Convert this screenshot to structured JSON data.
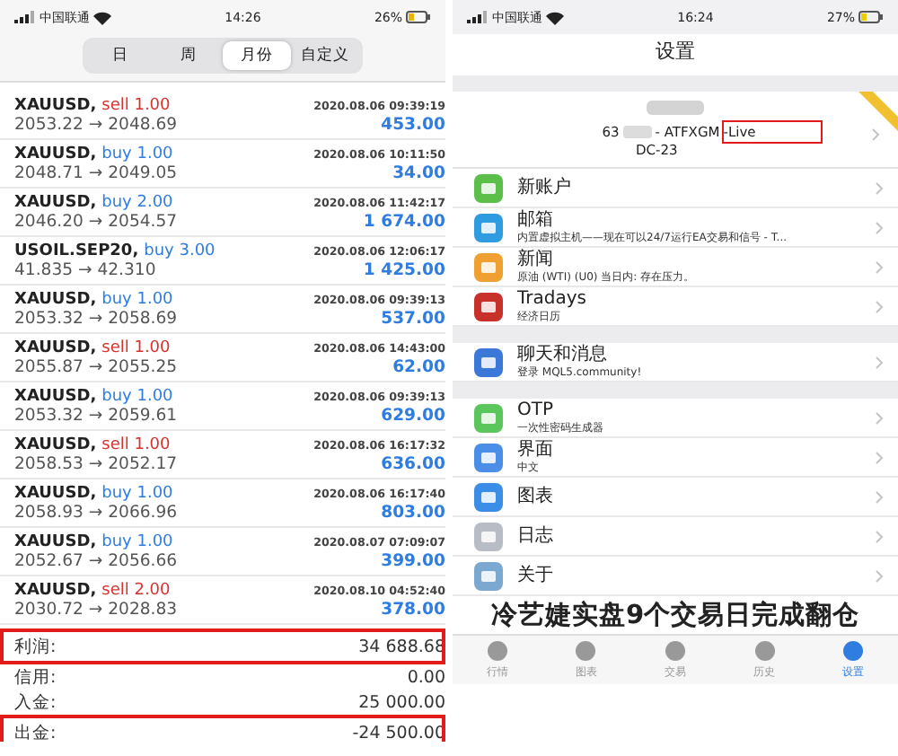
{
  "left_screen": {
    "status_bar": {
      "carrier": "中国联通",
      "time": "14:26",
      "battery": "26%"
    },
    "period_tabs": [
      {
        "label": "日",
        "selected": false
      },
      {
        "label": "周",
        "selected": false
      },
      {
        "label": "月份",
        "selected": true
      },
      {
        "label": "自定义",
        "selected": false
      }
    ],
    "trades": [
      {
        "symbol": "XAUUSD,",
        "kind": "sell",
        "volume": "sell 1.00",
        "prices": "2053.22 → 2048.69",
        "time": "2020.08.06 09:39:19",
        "profit": "453.00"
      },
      {
        "symbol": "XAUUSD,",
        "kind": "buy",
        "volume": "buy 1.00",
        "prices": "2048.71 → 2049.05",
        "time": "2020.08.06 10:11:50",
        "profit": "34.00"
      },
      {
        "symbol": "XAUUSD,",
        "kind": "buy",
        "volume": "buy 2.00",
        "prices": "2046.20 → 2054.57",
        "time": "2020.08.06 11:42:17",
        "profit": "1 674.00"
      },
      {
        "symbol": "USOIL.SEP20,",
        "kind": "buy",
        "volume": "buy 3.00",
        "prices": "41.835 → 42.310",
        "time": "2020.08.06 12:06:17",
        "profit": "1 425.00"
      },
      {
        "symbol": "XAUUSD,",
        "kind": "buy",
        "volume": "buy 1.00",
        "prices": "2053.32 → 2058.69",
        "time": "2020.08.06 09:39:13",
        "profit": "537.00"
      },
      {
        "symbol": "XAUUSD,",
        "kind": "sell",
        "volume": "sell 1.00",
        "prices": "2055.87 → 2055.25",
        "time": "2020.08.06 14:43:00",
        "profit": "62.00"
      },
      {
        "symbol": "XAUUSD,",
        "kind": "buy",
        "volume": "buy 1.00",
        "prices": "2053.32 → 2059.61",
        "time": "2020.08.06 09:39:13",
        "profit": "629.00"
      },
      {
        "symbol": "XAUUSD,",
        "kind": "sell",
        "volume": "sell 1.00",
        "prices": "2058.53 → 2052.17",
        "time": "2020.08.06 16:17:32",
        "profit": "636.00"
      },
      {
        "symbol": "XAUUSD,",
        "kind": "buy",
        "volume": "buy 1.00",
        "prices": "2058.93 → 2066.96",
        "time": "2020.08.06 16:17:40",
        "profit": "803.00"
      },
      {
        "symbol": "XAUUSD,",
        "kind": "buy",
        "volume": "buy 1.00",
        "prices": "2052.67 → 2056.66",
        "time": "2020.08.07 07:09:07",
        "profit": "399.00"
      },
      {
        "symbol": "XAUUSD,",
        "kind": "sell",
        "volume": "sell 2.00",
        "prices": "2030.72 → 2028.83",
        "time": "2020.08.10 04:52:40",
        "profit": "378.00"
      }
    ],
    "summary": [
      {
        "label": "利润:",
        "value": "34 688.68",
        "highlighted": true
      },
      {
        "label": "信用:",
        "value": "0.00",
        "highlighted": false
      },
      {
        "label": "入金:",
        "value": "25 000.00",
        "highlighted": false
      },
      {
        "label": "出金:",
        "value": "-24 500.00",
        "highlighted": true
      }
    ]
  },
  "right_screen": {
    "status_bar": {
      "carrier": "中国联通",
      "time": "16:24",
      "battery": "27%"
    },
    "title": "设置",
    "account": {
      "number": "63",
      "server": "- ATFXGM",
      "suffix": "-Live",
      "suffix_highlighted": true,
      "server_code": "DC-23"
    },
    "groups": [
      [
        {
          "title": "新账户"
        },
        {
          "title": "邮箱",
          "subtitle": "内置虚拟主机——现在可以24/7运行EA交易和信号 - T..."
        },
        {
          "title": "新闻",
          "subtitle": "原油 (WTI) (U0) 当日内: 存在压力。"
        },
        {
          "title": "Tradays",
          "subtitle": "经济日历"
        }
      ],
      [
        {
          "title": "聊天和消息",
          "subtitle": "登录 MQL5.community!"
        }
      ],
      [
        {
          "title": "OTP",
          "subtitle": "一次性密码生成器"
        },
        {
          "title": "界面",
          "subtitle": "中文"
        },
        {
          "title": "图表"
        },
        {
          "title": "日志"
        },
        {
          "title": "关于"
        }
      ]
    ],
    "caption": "冷艺婕实盘9个交易日完成翻仓",
    "tab_bar": [
      {
        "label": "行情",
        "selected": false
      },
      {
        "label": "图表",
        "selected": false
      },
      {
        "label": "交易",
        "selected": false
      },
      {
        "label": "历史",
        "selected": false
      },
      {
        "label": "设置",
        "selected": true
      }
    ]
  }
}
